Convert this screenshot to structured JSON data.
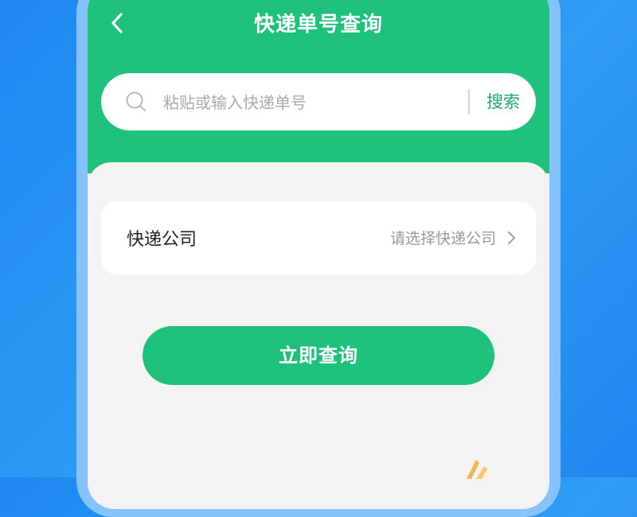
{
  "header": {
    "title": "快递单号查询"
  },
  "search": {
    "placeholder": "粘贴或输入快递单号",
    "button_label": "搜索"
  },
  "form": {
    "company_label": "快递公司",
    "company_value": "请选择快递公司"
  },
  "actions": {
    "query_label": "立即查询"
  },
  "colors": {
    "brand_green": "#1ec27a",
    "background_blue": "#1e88f0"
  },
  "icons": {
    "back": "chevron-left-icon",
    "search": "search-icon",
    "company_arrow": "chevron-right-icon"
  }
}
